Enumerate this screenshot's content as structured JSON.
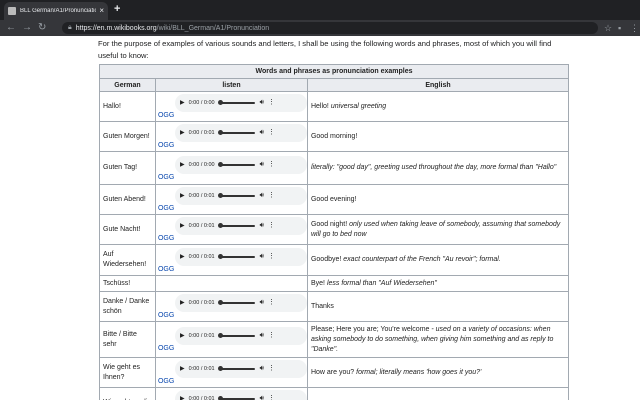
{
  "browser": {
    "tab_title": "BLL German/A1/Pronunciation",
    "tab_close": "×",
    "new_tab": "+",
    "url_host": "https://en.m.wikibooks.org",
    "url_path": "/wiki/BLL_German/A1/Pronunciation"
  },
  "page": {
    "intro": "For the purpose of examples of various sounds and letters, I shall be using the following words and phrases, most of which you will find useful to know:",
    "table": {
      "caption": "Words and phrases as pronunciation examples",
      "headers": [
        "German",
        "listen",
        "English"
      ],
      "ogg_label": "OGG",
      "rows": [
        {
          "de": "Hallo!",
          "time": "0:00 / 0:00",
          "en": "Hello!",
          "en_note": "universal greeting"
        },
        {
          "de": "Guten Morgen!",
          "time": "0:00 / 0:01",
          "en": "Good morning!",
          "en_note": ""
        },
        {
          "de": "Guten Tag!",
          "time": "0:00 / 0:00",
          "en": "",
          "en_note": "literally: \"good day\", greeting used throughout the day, more formal than \"Hallo\""
        },
        {
          "de": "Guten Abend!",
          "time": "0:00 / 0:01",
          "en": "Good evening!",
          "en_note": ""
        },
        {
          "de": "Gute Nacht!",
          "time": "0:00 / 0:01",
          "en": "Good night!",
          "en_note": "only used when taking leave of somebody, assuming that somebody will go to bed now"
        },
        {
          "de": "Auf Wiedersehen!",
          "time": "0:00 / 0:01",
          "en": "Goodbye!",
          "en_note": "exact counterpart of the French \"Au revoir\"; formal."
        },
        {
          "de": "Tschüss!",
          "time": "",
          "en": "Bye!",
          "en_note": "less formal than \"Auf Wiedersehen\""
        },
        {
          "de": "Danke / Danke schön",
          "time": "0:00 / 0:01",
          "en": "Thanks",
          "en_note": ""
        },
        {
          "de": "Bitte / Bitte sehr",
          "time": "0:00 / 0:01",
          "en": "Please; Here you are; You're welcome",
          "en_note": "- used on a variety of occasions: when asking somebody to do something, when giving him something and as reply to \"Danke\"."
        },
        {
          "de": "Wie geht es Ihnen?",
          "time": "0:00 / 0:01",
          "en": "How are you?",
          "en_note": "formal; literally means 'how goes it you?'"
        },
        {
          "de": "Wie geht es dir",
          "time": "0:00 / 0:01",
          "en": "",
          "en_note": ""
        }
      ]
    }
  }
}
